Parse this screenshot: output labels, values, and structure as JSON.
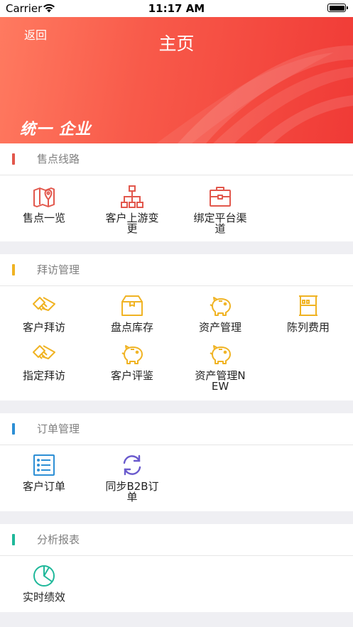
{
  "status_bar": {
    "carrier": "Carrier",
    "time": "11:17 AM"
  },
  "nav": {
    "back_label": "返回",
    "title": "主页",
    "brand_text": "统一 企业"
  },
  "sections": [
    {
      "title": "售点线路",
      "accent": "#e2574c",
      "items": [
        {
          "label": "售点一览",
          "icon": "map-pin-icon",
          "color": "#e2574c"
        },
        {
          "label": "客户上游变更",
          "icon": "hierarchy-icon",
          "color": "#e2574c"
        },
        {
          "label": "绑定平台渠道",
          "icon": "briefcase-icon",
          "color": "#e2574c"
        }
      ]
    },
    {
      "title": "拜访管理",
      "accent": "#f0b323",
      "items": [
        {
          "label": "客户拜访",
          "icon": "handshake-icon",
          "color": "#f0b323"
        },
        {
          "label": "盘点库存",
          "icon": "box-icon",
          "color": "#f0b323"
        },
        {
          "label": "资产管理",
          "icon": "piggy-bank-icon",
          "color": "#f0b323"
        },
        {
          "label": "陈列费用",
          "icon": "shelf-icon",
          "color": "#f0b323"
        },
        {
          "label": "指定拜访",
          "icon": "handshake-icon",
          "color": "#f0b323"
        },
        {
          "label": "客户评鉴",
          "icon": "piggy-bank-icon",
          "color": "#f0b323"
        },
        {
          "label": "资产管理NEW",
          "icon": "piggy-bank-icon",
          "color": "#f0b323"
        }
      ]
    },
    {
      "title": "订单管理",
      "accent": "#2d8fd5",
      "items": [
        {
          "label": "客户订单",
          "icon": "list-icon",
          "color": "#2d8fd5"
        },
        {
          "label": "同步B2B订单",
          "icon": "sync-icon",
          "color": "#6a5acd"
        }
      ]
    },
    {
      "title": "分析报表",
      "accent": "#1fb89a",
      "items": [
        {
          "label": "实时绩效",
          "icon": "pie-chart-icon",
          "color": "#1fb89a"
        }
      ]
    }
  ]
}
